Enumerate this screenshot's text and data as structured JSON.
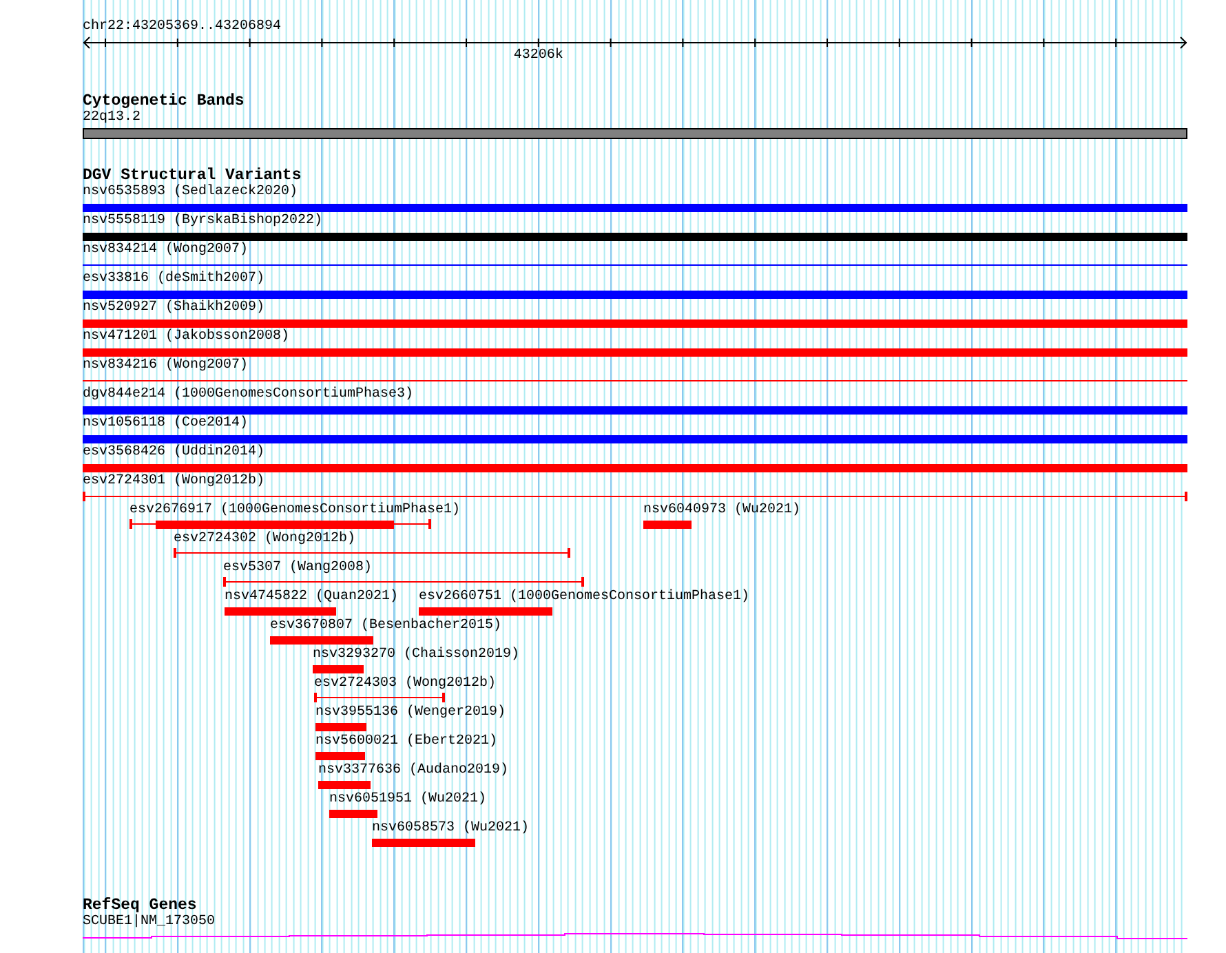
{
  "ruler": {
    "location": "chr22:43205369..43206894",
    "tick_label": "43206k"
  },
  "cytogenetic_bands": {
    "title": "Cytogenetic Bands",
    "band": "22q13.2"
  },
  "dgv_structural_variants": {
    "title": "DGV Structural Variants",
    "full_width_features": [
      {
        "label": "nsv6535893 (Sedlazeck2020)",
        "kind": "bar",
        "color": "#0000ff"
      },
      {
        "label": "nsv5558119 (ByrskaBishop2022)",
        "kind": "bar",
        "color": "#000000"
      },
      {
        "label": "nsv834214 (Wong2007)",
        "kind": "hairline",
        "color": "#0000ff"
      },
      {
        "label": "esv33816 (deSmith2007)",
        "kind": "bar",
        "color": "#0000ff"
      },
      {
        "label": "nsv520927 (Shaikh2009)",
        "kind": "bar",
        "color": "#ff0000"
      },
      {
        "label": "nsv471201 (Jakobsson2008)",
        "kind": "bar",
        "color": "#ff0000"
      },
      {
        "label": "nsv834216 (Wong2007)",
        "kind": "hairline",
        "color": "#ff0000"
      },
      {
        "label": "dgv844e214 (1000GenomesConsortiumPhase3)",
        "kind": "bar",
        "color": "#0000ff"
      },
      {
        "label": "nsv1056118 (Coe2014)",
        "kind": "bar",
        "color": "#0000ff"
      },
      {
        "label": "esv3568426 (Uddin2014)",
        "kind": "bar",
        "color": "#ff0000"
      },
      {
        "label": "esv2724301 (Wong2012b)",
        "kind": "span",
        "color": "#ff0000"
      }
    ],
    "stacked_rows": [
      {
        "features": [
          {
            "label": "esv2676917 (1000GenomesConsortiumPhase1)",
            "kind": "span_bar",
            "color": "#ff0000"
          },
          {
            "label": "nsv6040973 (Wu2021)",
            "kind": "bar",
            "color": "#ff0000"
          }
        ]
      },
      {
        "features": [
          {
            "label": "esv2724302 (Wong2012b)",
            "kind": "span",
            "color": "#ff0000"
          }
        ]
      },
      {
        "features": [
          {
            "label": "esv5307 (Wang2008)",
            "kind": "span",
            "color": "#ff0000"
          }
        ]
      },
      {
        "features": [
          {
            "label": "nsv4745822 (Quan2021)",
            "kind": "bar",
            "color": "#ff0000"
          },
          {
            "label": "esv2660751 (1000GenomesConsortiumPhase1)",
            "kind": "bar",
            "color": "#ff0000"
          }
        ]
      },
      {
        "features": [
          {
            "label": "esv3670807 (Besenbacher2015)",
            "kind": "bar",
            "color": "#ff0000"
          }
        ]
      },
      {
        "features": [
          {
            "label": "nsv3293270 (Chaisson2019)",
            "kind": "bar",
            "color": "#ff0000"
          }
        ]
      },
      {
        "features": [
          {
            "label": "esv2724303 (Wong2012b)",
            "kind": "span",
            "color": "#ff0000"
          }
        ]
      },
      {
        "features": [
          {
            "label": "nsv3955136 (Wenger2019)",
            "kind": "bar",
            "color": "#ff0000"
          }
        ]
      },
      {
        "features": [
          {
            "label": "nsv5600021 (Ebert2021)",
            "kind": "bar",
            "color": "#ff0000"
          }
        ]
      },
      {
        "features": [
          {
            "label": "nsv3377636 (Audano2019)",
            "kind": "bar",
            "color": "#ff0000"
          }
        ]
      },
      {
        "features": [
          {
            "label": "nsv6051951 (Wu2021)",
            "kind": "bar",
            "color": "#ff0000"
          }
        ]
      },
      {
        "features": [
          {
            "label": "nsv6058573 (Wu2021)",
            "kind": "bar",
            "color": "#ff0000"
          }
        ]
      }
    ]
  },
  "refseq_genes": {
    "title": "RefSeq Genes",
    "gene": "SCUBE1|NM_173050"
  }
}
